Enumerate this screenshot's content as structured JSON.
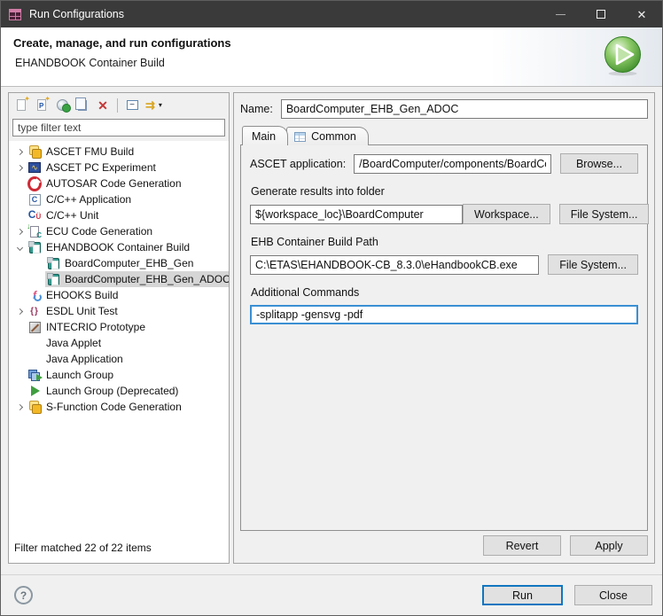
{
  "window": {
    "title": "Run Configurations"
  },
  "header": {
    "title": "Create, manage, and run configurations",
    "subtitle": "EHANDBOOK Container Build"
  },
  "left_panel": {
    "filter_placeholder": "type filter text",
    "status": "Filter matched 22 of 22 items",
    "tree": [
      {
        "label": "ASCET FMU Build"
      },
      {
        "label": "ASCET PC Experiment"
      },
      {
        "label": "AUTOSAR Code Generation"
      },
      {
        "label": "C/C++ Application"
      },
      {
        "label": "C/C++ Unit"
      },
      {
        "label": "ECU Code Generation"
      },
      {
        "label": "EHANDBOOK Container Build"
      },
      {
        "label": "BoardComputer_EHB_Gen"
      },
      {
        "label": "BoardComputer_EHB_Gen_ADOC"
      },
      {
        "label": "EHOOKS Build"
      },
      {
        "label": "ESDL Unit Test"
      },
      {
        "label": "INTECRIO Prototype"
      },
      {
        "label": "Java Applet"
      },
      {
        "label": "Java Application"
      },
      {
        "label": "Launch Group"
      },
      {
        "label": "Launch Group (Deprecated)"
      },
      {
        "label": "S-Function Code Generation"
      }
    ]
  },
  "right_panel": {
    "name_label": "Name:",
    "name_value": "BoardComputer_EHB_Gen_ADOC",
    "tabs": [
      {
        "label": "Main"
      },
      {
        "label": "Common"
      }
    ],
    "main": {
      "ascet_label": "ASCET application:",
      "ascet_value": "/BoardComputer/components/BoardComput",
      "browse": "Browse...",
      "folder_label": "Generate results into folder",
      "folder_value": "${workspace_loc}\\BoardComputer",
      "workspace": "Workspace...",
      "file_system": "File System...",
      "ehb_label": "EHB Container Build Path",
      "ehb_value": "C:\\ETAS\\EHANDBOOK-CB_8.3.0\\eHandbookCB.exe",
      "ehb_file_system": "File System...",
      "commands_label": "Additional Commands",
      "commands_value": "-splitapp -gensvg -pdf"
    },
    "revert": "Revert",
    "apply": "Apply"
  },
  "footer": {
    "run": "Run",
    "close": "Close"
  },
  "icons": {
    "sparkle": "✦",
    "prototype_letter": "P",
    "delete": "✕",
    "collapse": "−",
    "filter": "⇉",
    "dropdown": "▾",
    "close": "✕",
    "help": "?",
    "c_letter": "C",
    "u_letter": "Ü",
    "ecu_arrow": "↓",
    "braces": "{}",
    "hook_letter": "f",
    "wave": "∿"
  },
  "colors": {
    "accent": "#0078d7",
    "titlebar": "#3a3a3a",
    "selection": "#d6d6d6",
    "run_green": "#4c9a34",
    "delete_red": "#c53636"
  }
}
